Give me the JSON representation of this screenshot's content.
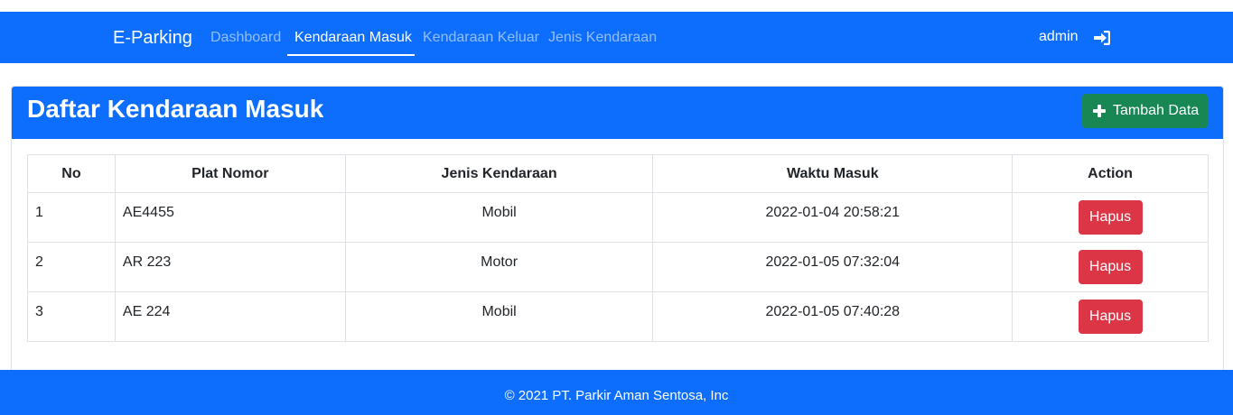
{
  "navbar": {
    "brand": "E-Parking",
    "links": [
      {
        "label": "Dashboard",
        "active": false
      },
      {
        "label": "Kendaraan Masuk",
        "active": true
      },
      {
        "label": "Kendaraan Keluar",
        "active": false
      },
      {
        "label": "Jenis Kendaraan",
        "active": false
      }
    ],
    "user": "admin",
    "logout_icon": "sign-in-icon"
  },
  "card": {
    "title": "Daftar Kendaraan Masuk",
    "add_button_label": "Tambah Data",
    "add_button_icon": "plus-icon"
  },
  "table": {
    "headers": [
      "No",
      "Plat Nomor",
      "Jenis Kendaraan",
      "Waktu Masuk",
      "Action"
    ],
    "rows": [
      {
        "no": "1",
        "plat": "AE4455",
        "jenis": "Mobil",
        "waktu": "2022-01-04 20:58:21",
        "action": "Hapus"
      },
      {
        "no": "2",
        "plat": "AR 223",
        "jenis": "Motor",
        "waktu": "2022-01-05 07:32:04",
        "action": "Hapus"
      },
      {
        "no": "3",
        "plat": "AE 224",
        "jenis": "Mobil",
        "waktu": "2022-01-05 07:40:28",
        "action": "Hapus"
      }
    ]
  },
  "footer": {
    "text": "© 2021 PT. Parkir Aman Sentosa, Inc"
  },
  "colors": {
    "primary": "#0d6efd",
    "success": "#198754",
    "danger": "#dc3545"
  }
}
